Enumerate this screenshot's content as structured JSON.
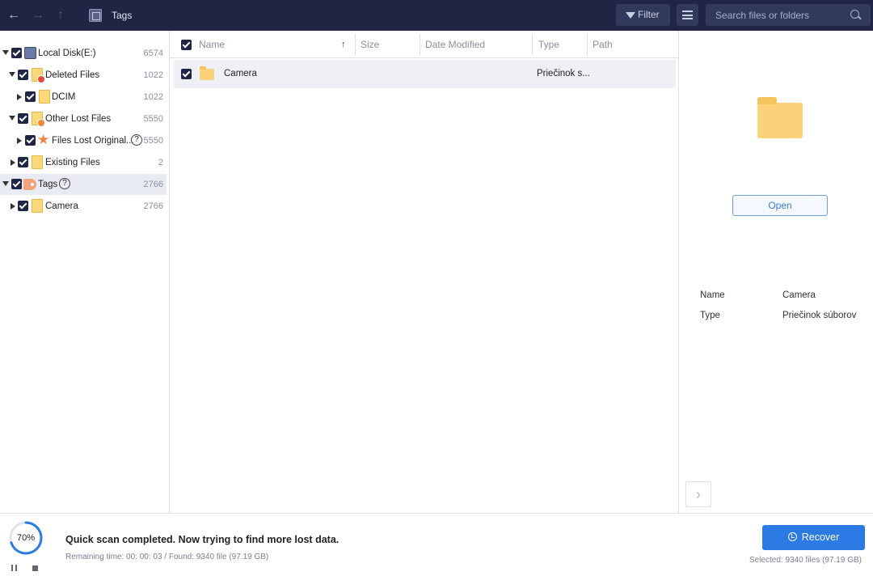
{
  "topbar": {
    "breadcrumb": "Tags",
    "filter_label": "Filter",
    "search_placeholder": "Search files or folders"
  },
  "tree": {
    "items": [
      {
        "label": "Local Disk(E:)",
        "count": "6574",
        "icon": "disk-icon"
      },
      {
        "label": "Deleted Files",
        "count": "1022",
        "icon": "deleted-folder-icon"
      },
      {
        "label": "DCIM",
        "count": "1022",
        "icon": "folder-icon"
      },
      {
        "label": "Other Lost Files",
        "count": "5550",
        "icon": "lost-folder-icon"
      },
      {
        "label": "Files Lost Original...",
        "count": "5550",
        "icon": "star-icon"
      },
      {
        "label": "Existing Files",
        "count": "2",
        "icon": "folder-icon"
      },
      {
        "label": "Tags",
        "count": "2766",
        "icon": "tag-icon"
      },
      {
        "label": "Camera",
        "count": "2766",
        "icon": "folder-icon"
      }
    ],
    "help_mark": "?"
  },
  "list": {
    "columns": [
      "Name",
      "Size",
      "Date Modified",
      "Type",
      "Path"
    ],
    "rows": [
      {
        "name": "Camera",
        "size": "",
        "date": "",
        "type": "Priečinok s...",
        "path": ""
      }
    ]
  },
  "preview": {
    "open_label": "Open",
    "name_label": "Name",
    "name_value": "Camera",
    "type_label": "Type",
    "type_value": "Priečinok súborov"
  },
  "status": {
    "progress_percent": 70,
    "progress_text": "70%",
    "main": "Quick scan completed. Now trying to find more lost data.",
    "sub": "Remaining time: 00: 00: 03 / Found: 9340 file (97.19 GB)",
    "recover_label": "Recover",
    "selected": "Selected: 9340 files (97.19 GB)"
  },
  "colors": {
    "topbar": "#1f2542",
    "accent": "#2c7be5",
    "folder": "#fbd27a"
  }
}
